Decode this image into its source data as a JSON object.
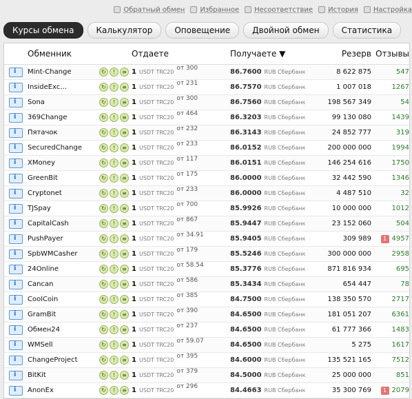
{
  "top_links": [
    {
      "label": "Обратный обмен",
      "icon": "settings-small-icon"
    },
    {
      "label": "Избранное",
      "icon": "heart-icon"
    },
    {
      "label": "Несоответствие",
      "icon": "warning-icon"
    },
    {
      "label": "История",
      "icon": "clock-icon"
    },
    {
      "label": "Настройка",
      "icon": "wrench-icon"
    }
  ],
  "tabs": [
    {
      "label": "Курсы обмена",
      "active": true
    },
    {
      "label": "Калькулятор",
      "active": false
    },
    {
      "label": "Оповещение",
      "active": false
    },
    {
      "label": "Двойной обмен",
      "active": false
    },
    {
      "label": "Статистика",
      "active": false
    }
  ],
  "header": {
    "col_exchanger": "Обменник",
    "col_give": "Отдаете",
    "col_get": "Получаете ▼",
    "col_reserve": "Резерв",
    "col_reviews": "Отзывы"
  },
  "rows": [
    {
      "name": "Mint-Change",
      "give": "1",
      "give_unit": "USDT TRC20",
      "min": "от 300",
      "rate": "86.7600",
      "rate_unit": "RUB Сбербанк",
      "reserve": "8 622 875",
      "reviews": "547",
      "bad": ""
    },
    {
      "name": "InsideExc...",
      "give": "1",
      "give_unit": "USDT TRC20",
      "min": "от 231",
      "rate": "86.7570",
      "rate_unit": "RUB Сбербанк",
      "reserve": "1 007 018",
      "reviews": "1267",
      "bad": ""
    },
    {
      "name": "Sona",
      "give": "1",
      "give_unit": "USDT TRC20",
      "min": "от 300",
      "rate": "86.7560",
      "rate_unit": "RUB Сбербанк",
      "reserve": "198 567 349",
      "reviews": "54",
      "bad": ""
    },
    {
      "name": "369Change",
      "give": "1",
      "give_unit": "USDT TRC20",
      "min": "от 464",
      "rate": "86.3203",
      "rate_unit": "RUB Сбербанк",
      "reserve": "99 130 080",
      "reviews": "1439",
      "bad": ""
    },
    {
      "name": "Пятачок",
      "give": "1",
      "give_unit": "USDT TRC20",
      "min": "от 232",
      "rate": "86.3143",
      "rate_unit": "RUB Сбербанк",
      "reserve": "24 852 777",
      "reviews": "319",
      "bad": ""
    },
    {
      "name": "SecuredChange",
      "give": "1",
      "give_unit": "USDT TRC20",
      "min": "от 233",
      "rate": "86.0152",
      "rate_unit": "RUB Сбербанк",
      "reserve": "200 000 000",
      "reviews": "1994",
      "bad": ""
    },
    {
      "name": "XMoney",
      "give": "1",
      "give_unit": "USDT TRC20",
      "min": "от 117",
      "rate": "86.0151",
      "rate_unit": "RUB Сбербанк",
      "reserve": "146 254 616",
      "reviews": "1750",
      "bad": ""
    },
    {
      "name": "GreenBit",
      "give": "1",
      "give_unit": "USDT TRC20",
      "min": "от 175",
      "rate": "86.0000",
      "rate_unit": "RUB Сбербанк",
      "reserve": "32 442 590",
      "reviews": "1346",
      "bad": ""
    },
    {
      "name": "Cryptonet",
      "give": "1",
      "give_unit": "USDT TRC20",
      "min": "от 233",
      "rate": "86.0000",
      "rate_unit": "RUB Сбербанк",
      "reserve": "4 487 510",
      "reviews": "32",
      "bad": ""
    },
    {
      "name": "TJSpay",
      "give": "1",
      "give_unit": "USDT TRC20",
      "min": "от 700",
      "rate": "85.9926",
      "rate_unit": "RUB Сбербанк",
      "reserve": "10 000 000",
      "reviews": "1012",
      "bad": ""
    },
    {
      "name": "CapitalCash",
      "give": "1",
      "give_unit": "USDT TRC20",
      "min": "от 867",
      "rate": "85.9447",
      "rate_unit": "RUB Сбербанк",
      "reserve": "23 152 060",
      "reviews": "504",
      "bad": ""
    },
    {
      "name": "PushPayer",
      "give": "1",
      "give_unit": "USDT TRC20",
      "min": "от 34.91",
      "rate": "85.9405",
      "rate_unit": "RUB Сбербанк",
      "reserve": "309 989",
      "reviews": "4957",
      "bad": "1"
    },
    {
      "name": "SpbWMCasher",
      "give": "1",
      "give_unit": "USDT TRC20",
      "min": "от 179",
      "rate": "85.5246",
      "rate_unit": "RUB Сбербанк",
      "reserve": "300 000 000",
      "reviews": "2958",
      "bad": ""
    },
    {
      "name": "24Online",
      "give": "1",
      "give_unit": "USDT TRC20",
      "min": "от 58.54",
      "rate": "85.3776",
      "rate_unit": "RUB Сбербанк",
      "reserve": "871 816 934",
      "reviews": "695",
      "bad": ""
    },
    {
      "name": "Cancan",
      "give": "1",
      "give_unit": "USDT TRC20",
      "min": "от 586",
      "rate": "85.3434",
      "rate_unit": "RUB Сбербанк",
      "reserve": "654 447",
      "reviews": "78",
      "bad": ""
    },
    {
      "name": "CoolCoin",
      "give": "1",
      "give_unit": "USDT TRC20",
      "min": "от 385",
      "rate": "84.7500",
      "rate_unit": "RUB Сбербанк",
      "reserve": "138 350 570",
      "reviews": "2717",
      "bad": ""
    },
    {
      "name": "GramBit",
      "give": "1",
      "give_unit": "USDT TRC20",
      "min": "от 390",
      "rate": "84.6500",
      "rate_unit": "RUB Сбербанк",
      "reserve": "181 051 207",
      "reviews": "6361",
      "bad": ""
    },
    {
      "name": "Обмен24",
      "give": "1",
      "give_unit": "USDT TRC20",
      "min": "от 237",
      "rate": "84.6500",
      "rate_unit": "RUB Сбербанк",
      "reserve": "61 777 366",
      "reviews": "1483",
      "bad": ""
    },
    {
      "name": "WMSell",
      "give": "1",
      "give_unit": "USDT TRC20",
      "min": "от 59.07",
      "rate": "84.6500",
      "rate_unit": "RUB Сбербанк",
      "reserve": "5 275",
      "reviews": "1617",
      "bad": ""
    },
    {
      "name": "ChangeProject",
      "give": "1",
      "give_unit": "USDT TRC20",
      "min": "от 395",
      "rate": "84.6000",
      "rate_unit": "RUB Сбербанк",
      "reserve": "135 521 165",
      "reviews": "7512",
      "bad": ""
    },
    {
      "name": "BitKit",
      "give": "1",
      "give_unit": "USDT TRC20",
      "min": "от 379",
      "rate": "84.5000",
      "rate_unit": "RUB Сбербанк",
      "reserve": "25 000 000",
      "reviews": "851",
      "bad": ""
    },
    {
      "name": "AnonEx",
      "give": "1",
      "give_unit": "USDT TRC20",
      "min": "от 296",
      "rate": "84.4663",
      "rate_unit": "RUB Сбербанк",
      "reserve": "35 300 769",
      "reviews": "2079",
      "bad": "1"
    }
  ]
}
